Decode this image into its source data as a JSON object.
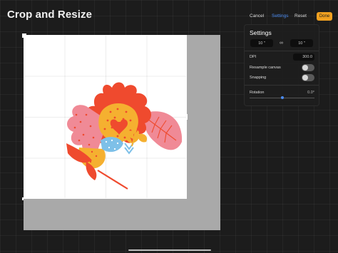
{
  "app": {
    "title": "Crop and Resize"
  },
  "toolbar": {
    "cancel_label": "Cancel",
    "settings_label": "Settings",
    "reset_label": "Reset",
    "done_label": "Done"
  },
  "settings": {
    "title": "Settings",
    "width_value": "10 \"",
    "height_value": "10 \"",
    "link_icon": "link-icon",
    "dpi_label": "DPI",
    "dpi_value": "300.0",
    "resample_label": "Resample canvas",
    "resample_on": false,
    "snapping_label": "Snapping",
    "snapping_on": false,
    "rotation_label": "Rotation",
    "rotation_value": "0.0°",
    "rotation_level": 0.5
  },
  "colors": {
    "accent": "#4b8bf0",
    "done": "#f0a020",
    "background": "#1c1c1c",
    "flower_red": "#ef4a2e",
    "flower_pink": "#f08a96",
    "flower_yellow": "#f5b030",
    "flower_blue": "#7ec0e8"
  }
}
